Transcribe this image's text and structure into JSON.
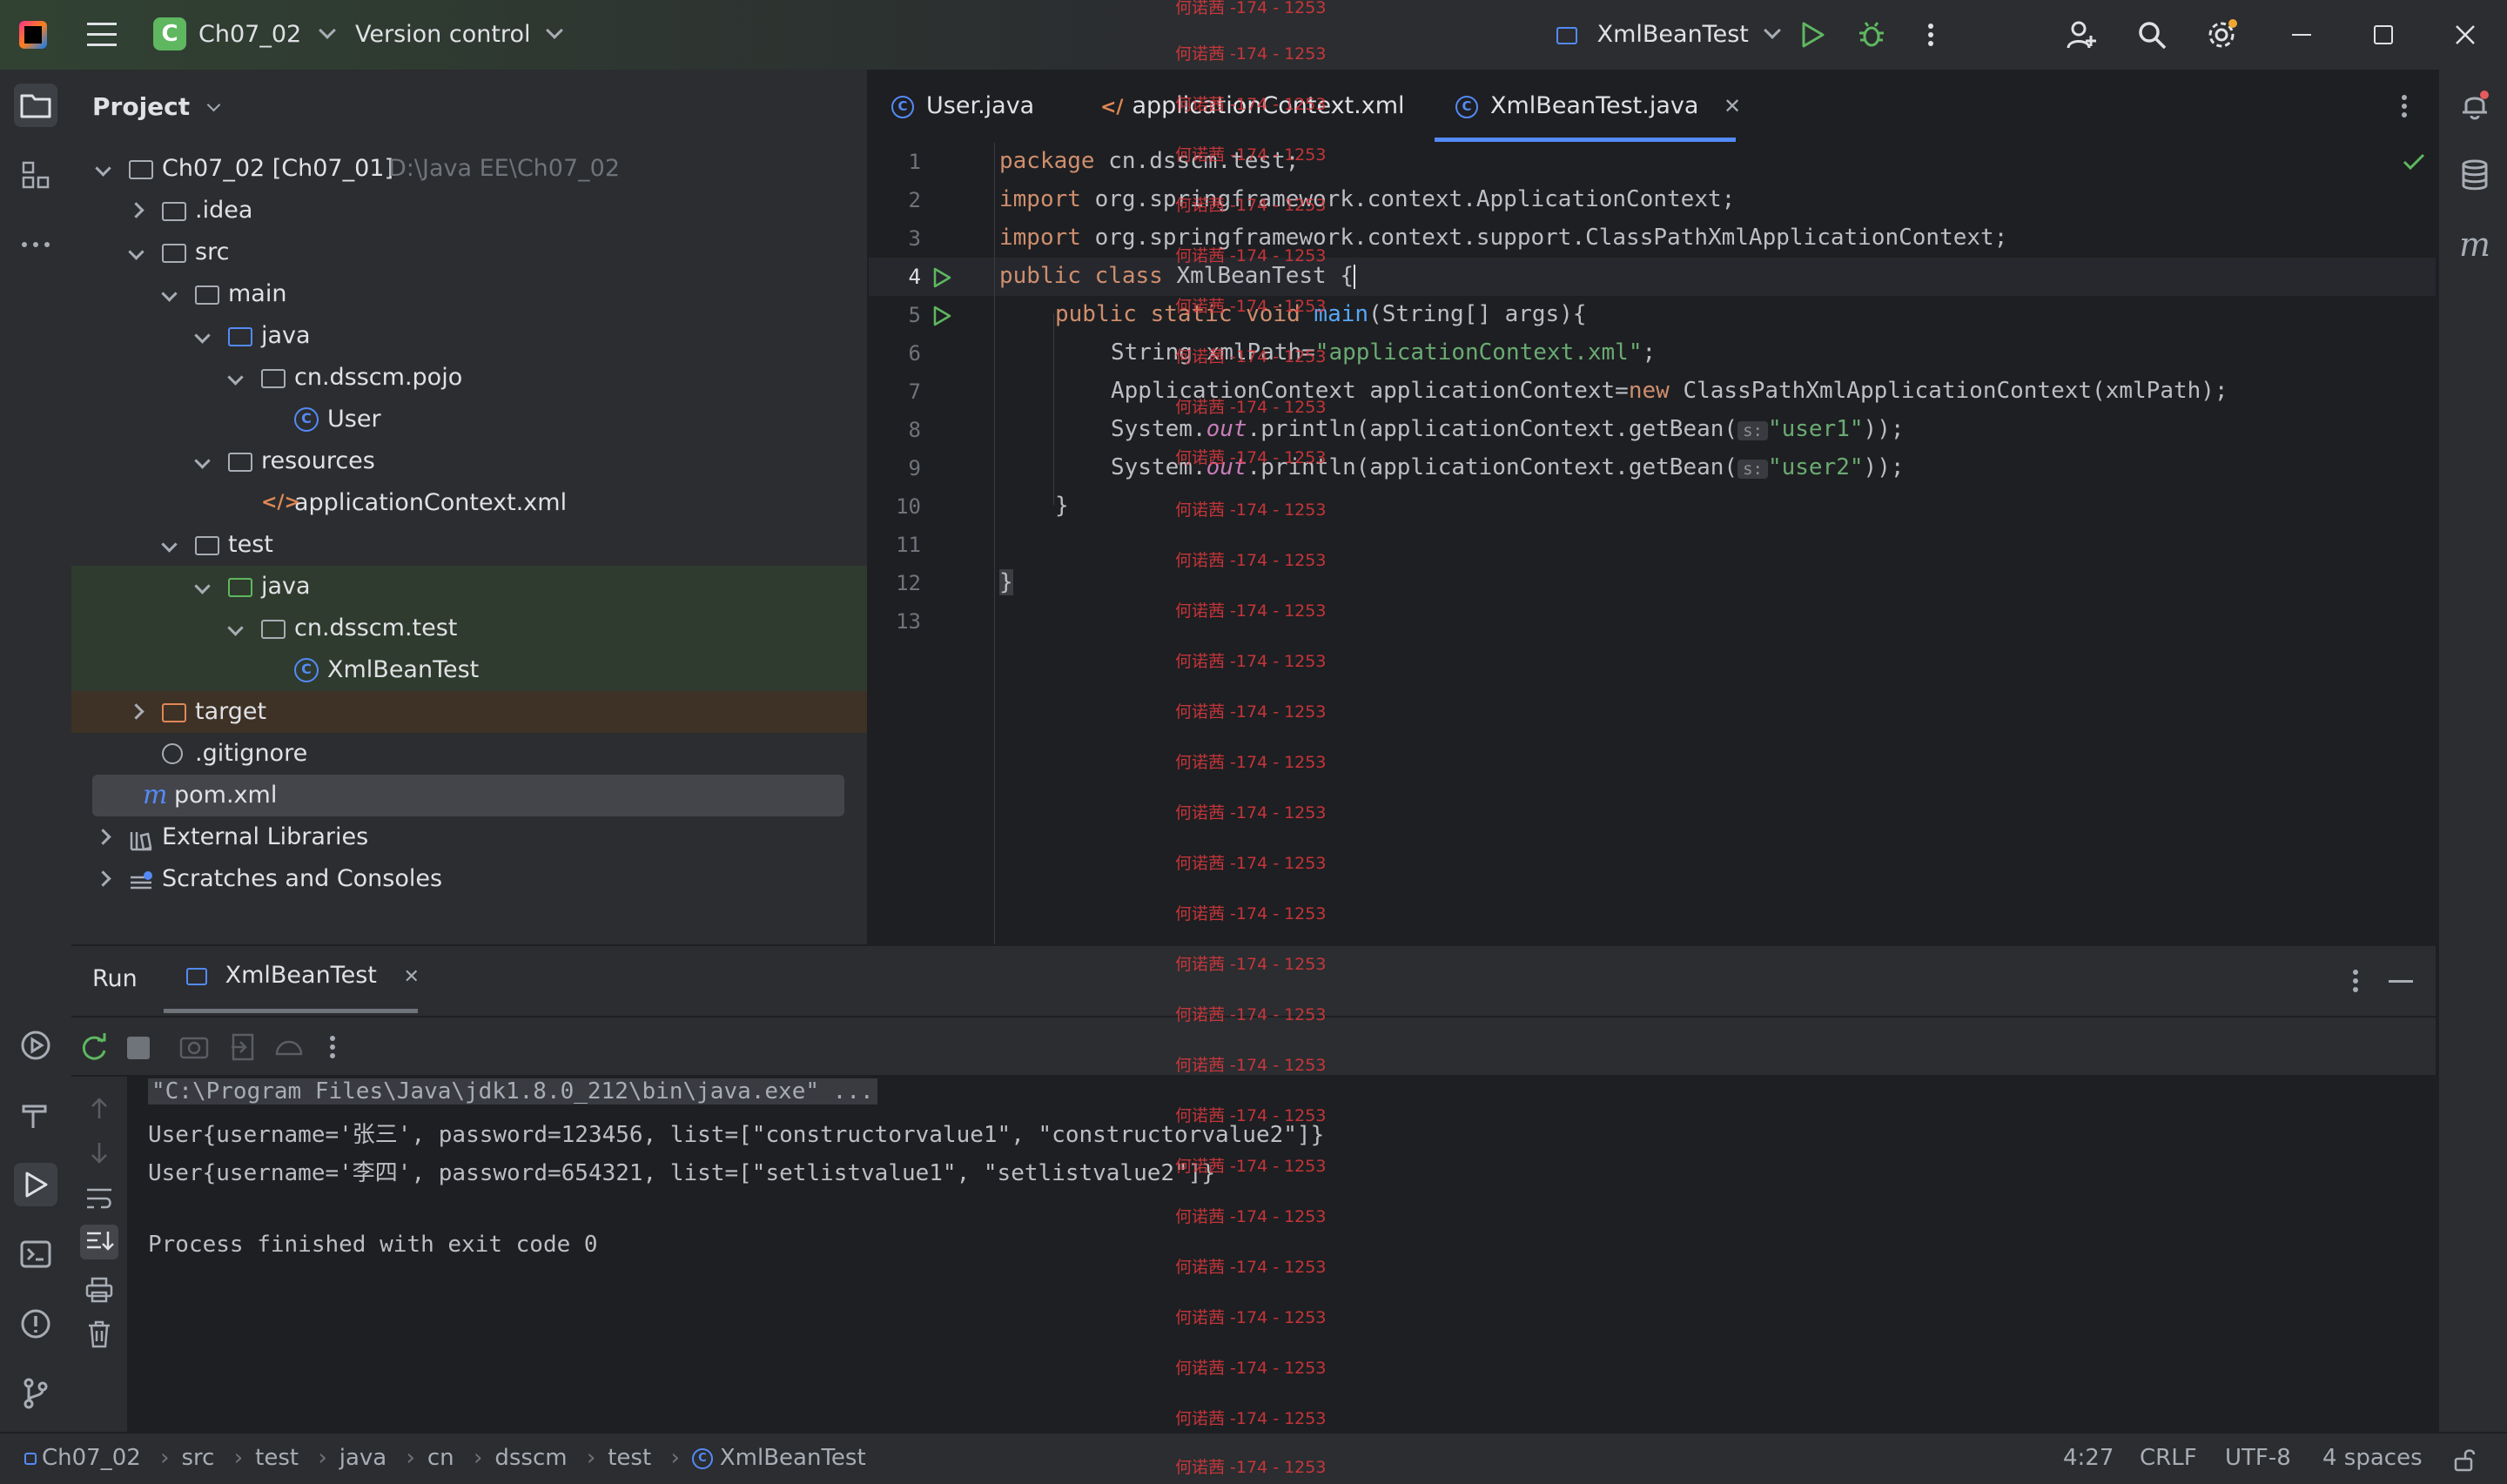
{
  "titlebar": {
    "project_badge": "C",
    "project_name": "Ch07_02",
    "vcs_label": "Version control",
    "run_config": "XmlBeanTest"
  },
  "project_panel": {
    "title": "Project",
    "tree": [
      {
        "label": "Ch07_02 [Ch07_01]",
        "path": "D:\\Java EE\\Ch07_02"
      },
      {
        "label": ".idea"
      },
      {
        "label": "src"
      },
      {
        "label": "main"
      },
      {
        "label": "java"
      },
      {
        "label": "cn.dsscm.pojo"
      },
      {
        "label": "User"
      },
      {
        "label": "resources"
      },
      {
        "label": "applicationContext.xml"
      },
      {
        "label": "test"
      },
      {
        "label": "java"
      },
      {
        "label": "cn.dsscm.test"
      },
      {
        "label": "XmlBeanTest"
      },
      {
        "label": "target"
      },
      {
        "label": ".gitignore"
      },
      {
        "label": "pom.xml"
      },
      {
        "label": "External Libraries"
      },
      {
        "label": "Scratches and Consoles"
      }
    ]
  },
  "editor": {
    "tabs": [
      {
        "label": "User.java"
      },
      {
        "label": "applicationContext.xml"
      },
      {
        "label": "XmlBeanTest.java"
      }
    ],
    "line_numbers": [
      "1",
      "2",
      "3",
      "4",
      "5",
      "6",
      "7",
      "8",
      "9",
      "10",
      "11",
      "12",
      "13"
    ],
    "code": {
      "l1_kw": "package",
      "l1_rest": " cn.dsscm.test;",
      "l2_kw": "import",
      "l2_rest": " org.springframework.context.ApplicationContext;",
      "l3_kw": "import",
      "l3_rest": " org.springframework.context.support.ClassPathXmlApplicationContext;",
      "l4_kw": "public class",
      "l4_rest": " XmlBeanTest {",
      "l5_kw": "public static void",
      "l5_fn": " main",
      "l5_rest": "(String[] args){",
      "l6_a": "String xmlPath=",
      "l6_str": "\"applicationContext.xml\"",
      "l6_b": ";",
      "l7_a": "ApplicationContext applicationContext=",
      "l7_kw": "new",
      "l7_b": " ClassPathXmlApplicationContext(xmlPath);",
      "l8_a": "System.",
      "l8_it": "out",
      "l8_b": ".println(applicationContext.getBean(",
      "l8_hint": "s:",
      "l8_str": "\"user1\"",
      "l8_c": "));",
      "l9_a": "System.",
      "l9_it": "out",
      "l9_b": ".println(applicationContext.getBean(",
      "l9_hint": "s:",
      "l9_str": "\"user2\"",
      "l9_c": "));",
      "l10": "}",
      "l12": "}"
    }
  },
  "run_panel": {
    "title": "Run",
    "tab": "XmlBeanTest",
    "console": [
      "\"C:\\Program Files\\Java\\jdk1.8.0_212\\bin\\java.exe\" ...",
      "User{username='张三', password=123456, list=[\"constructorvalue1\", \"constructorvalue2\"]}",
      "User{username='李四', password=654321, list=[\"setlistvalue1\", \"setlistvalue2\"]}",
      "",
      "Process finished with exit code 0"
    ]
  },
  "statusbar": {
    "breadcrumbs": [
      "Ch07_02",
      "src",
      "test",
      "java",
      "cn",
      "dsscm",
      "test",
      "XmlBeanTest"
    ],
    "position": "4:27",
    "line_sep": "CRLF",
    "encoding": "UTF-8",
    "indent": "4 spaces"
  },
  "watermark": "何诺茜 -174 - 1253",
  "colors": {
    "accent": "#548af7",
    "run_green": "#5fb760",
    "keyword": "#cf8e6d",
    "string": "#6aab73",
    "watermark": "#e0393e"
  }
}
